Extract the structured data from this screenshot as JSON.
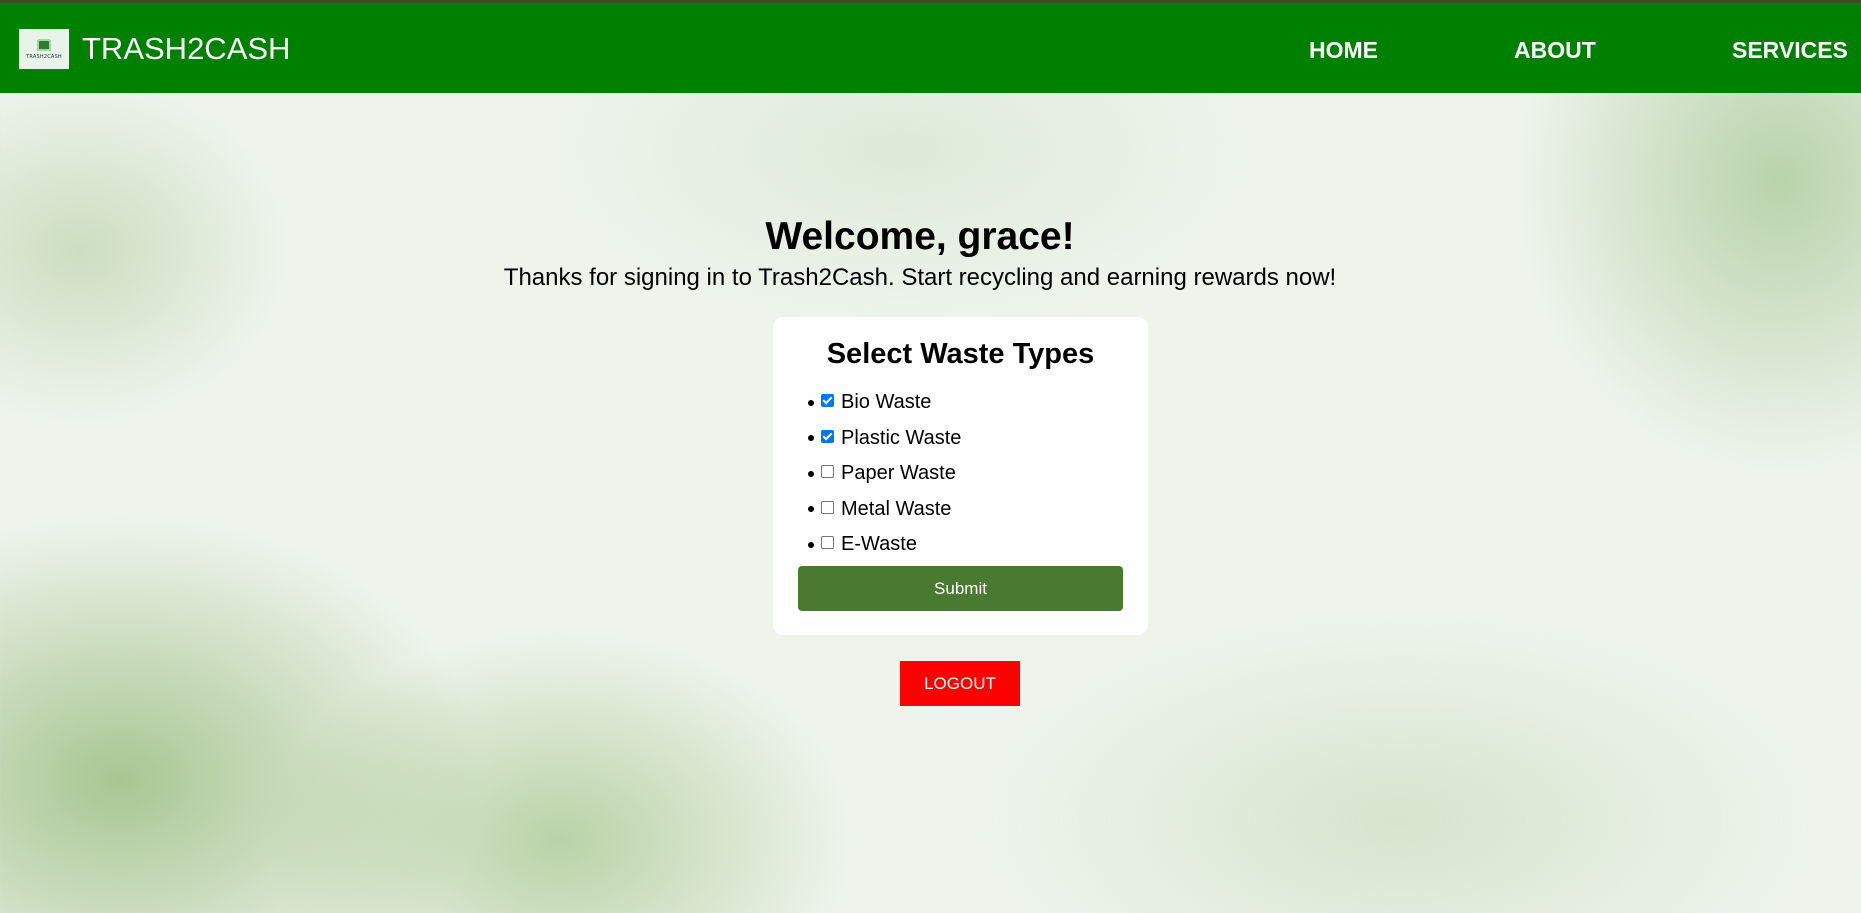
{
  "header": {
    "brand": "TRASH2CASH",
    "logo_text": "TRASH2CASH",
    "nav": [
      {
        "label": "HOME"
      },
      {
        "label": "ABOUT"
      },
      {
        "label": "SERVICES"
      }
    ]
  },
  "main": {
    "welcome": "Welcome, grace!",
    "subtitle": "Thanks for signing in to Trash2Cash. Start recycling and earning rewards now!",
    "form": {
      "title": "Select Waste Types",
      "options": [
        {
          "label": "Bio Waste",
          "checked": true
        },
        {
          "label": "Plastic Waste",
          "checked": true
        },
        {
          "label": "Paper Waste",
          "checked": false
        },
        {
          "label": "Metal Waste",
          "checked": false
        },
        {
          "label": "E-Waste",
          "checked": false
        }
      ],
      "submit_label": "Submit"
    },
    "logout_label": "LOGOUT"
  },
  "colors": {
    "navbar": "#008000",
    "submit": "#4a7a2f",
    "logout": "#ff0000",
    "checkbox_checked": "#0075ff"
  }
}
